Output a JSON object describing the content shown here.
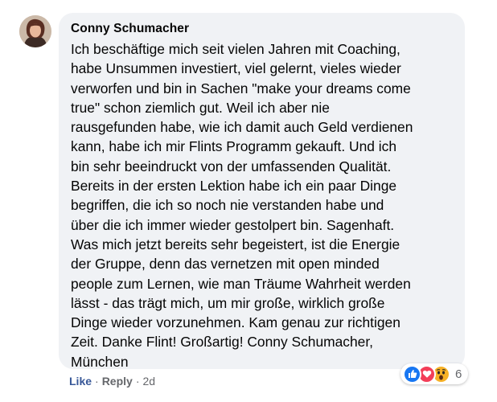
{
  "comment": {
    "author": "Conny Schumacher",
    "text": "Ich beschäftige mich seit vielen Jahren mit Coaching,\nhabe Unsummen investiert, viel gelernt, vieles wieder\nverworfen und bin in Sachen \"make your dreams come\ntrue\" schon ziemlich gut. Weil ich aber nie\nrausgefunden habe, wie ich damit auch Geld verdienen\nkann, habe ich mir Flints Programm gekauft. Und ich\nbin sehr beeindruckt von der umfassenden Qualität.\nBereits in der ersten Lektion habe ich ein paar Dinge\nbegriffen, die ich so noch nie verstanden habe und\nüber die ich immer wieder gestolpert bin. Sagenhaft.\nWas mich jetzt bereits sehr begeistert, ist die Energie\nder Gruppe, denn das vernetzen mit open minded\npeople zum Lernen, wie man Träume Wahrheit werden\nlässt - das trägt mich, um mir große, wirklich große\nDinge wieder vorzunehmen. Kam genau zur richtigen\nZeit. Danke Flint! Großartig! Conny Schumacher,\nMünchen"
  },
  "actions": {
    "like_label": "Like",
    "separator": "·",
    "reply_label": "Reply",
    "time": "2d"
  },
  "reactions": {
    "icons": [
      "like-reaction-icon",
      "love-reaction-icon",
      "wow-reaction-icon"
    ],
    "count": "6"
  },
  "colors": {
    "bubble": "#f0f2f5",
    "like_link": "#385898",
    "like_blue": "#1877f2",
    "love_red": "#f33e58",
    "wow_yellow": "#f7b125"
  }
}
